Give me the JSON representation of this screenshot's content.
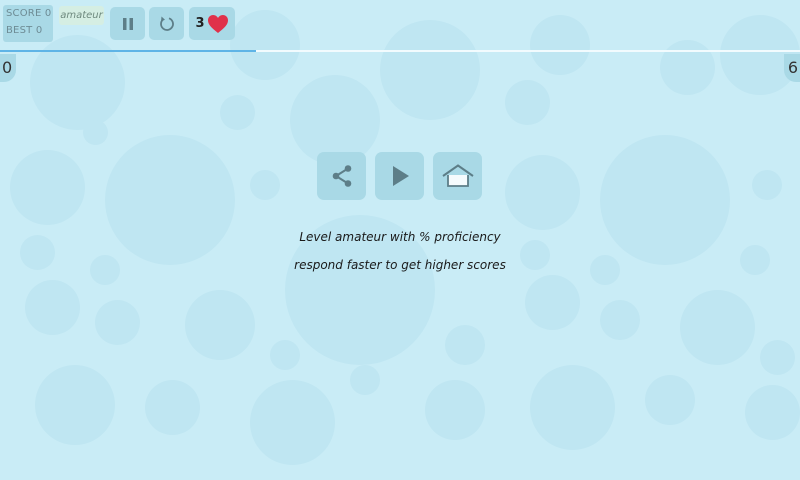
{
  "hud": {
    "score_label": "SCORE",
    "score_value": "0",
    "best_label": "BEST",
    "best_value": "0",
    "level": "amateur",
    "lives": "3"
  },
  "progress": {
    "fraction": 0.32
  },
  "counters": {
    "left": "0",
    "right": "6"
  },
  "menu": {
    "buttons": [
      {
        "icon": "share-icon"
      },
      {
        "icon": "play-icon"
      },
      {
        "icon": "home-icon"
      }
    ]
  },
  "message": {
    "line1": "Level amateur with % proficiency",
    "line2": "respond faster to get higher scores"
  },
  "colors": {
    "background": "#c9ecf6",
    "panel": "#a9d9e6",
    "progress": "#5fb4e6",
    "heart": "#e0314a"
  }
}
